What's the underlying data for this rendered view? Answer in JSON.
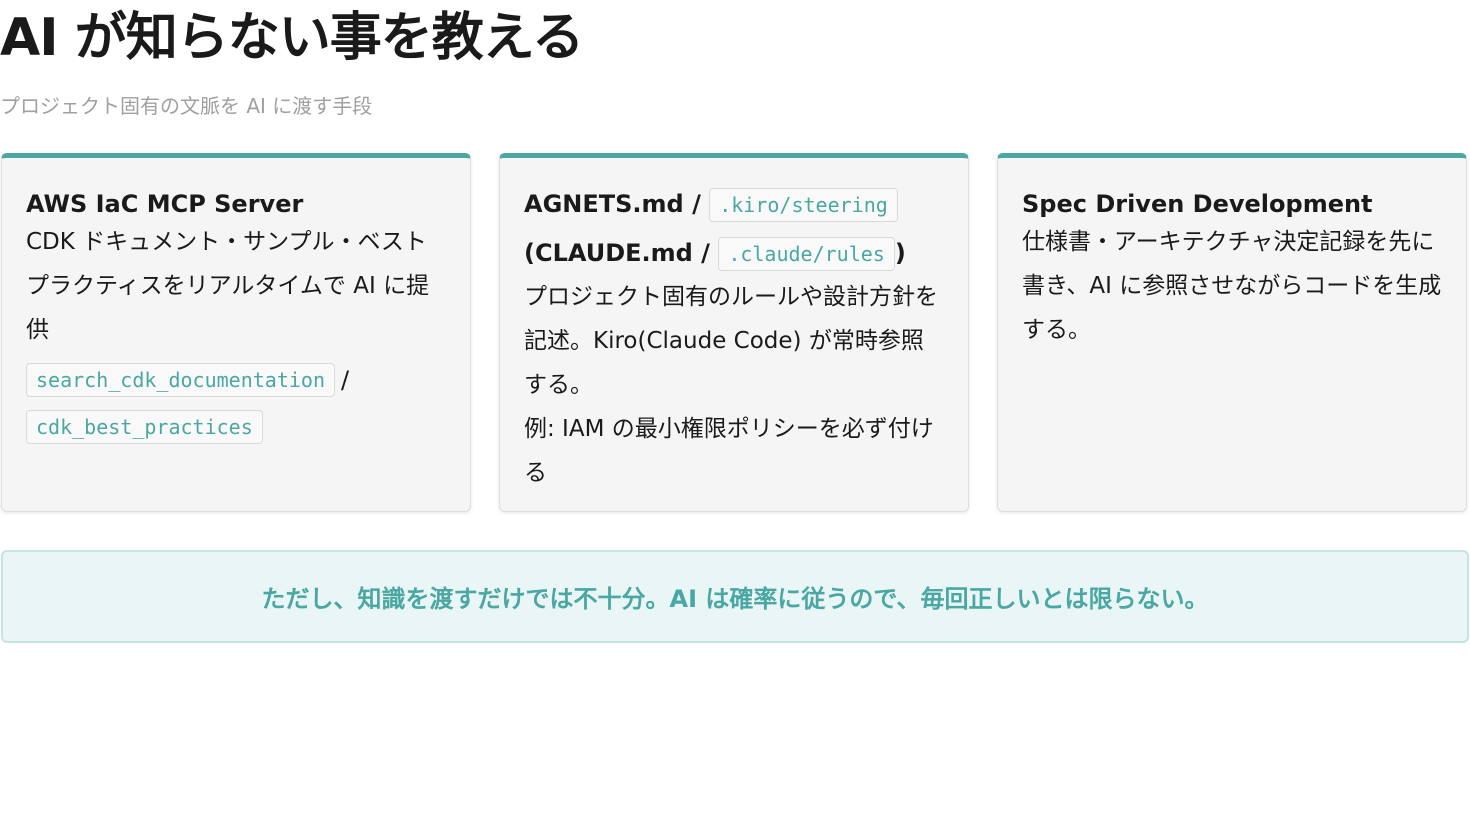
{
  "header": {
    "title": "AI が知らない事を教える",
    "subtitle": "プロジェクト固有の文脈を AI に渡す手段"
  },
  "cards": [
    {
      "title": "AWS IaC MCP Server",
      "body": "CDK ドキュメント・サンプル・ベストプラクティスをリアルタイムで AI に提供",
      "codes": [
        "search_cdk_documentation",
        "cdk_best_practices"
      ],
      "separator": "/"
    },
    {
      "title_prefix": "AGNETS.md /",
      "title_code": ".kiro/steering",
      "title_paren_prefix": "(CLAUDE.md /",
      "title_paren_code": ".claude/rules",
      "title_paren_suffix": ")",
      "body": "プロジェクト固有のルールや設計方針を記述。Kiro(Claude Code) が常時参照する。",
      "example": "例: IAM の最小権限ポリシーを必ず付ける"
    },
    {
      "title": "Spec Driven Development",
      "body": "仕様書・アーキテクチャ決定記録を先に書き、AI に参照させながらコードを生成する。"
    }
  ],
  "callout": {
    "text": "ただし、知識を渡すだけでは不十分。AI は確率に従うので、毎回正しいとは限らない。"
  },
  "colors": {
    "accent": "#4aa7a3",
    "card_background": "#f5f5f5",
    "callout_background": "#eaf6f5",
    "subtitle": "#a0a0a0"
  }
}
